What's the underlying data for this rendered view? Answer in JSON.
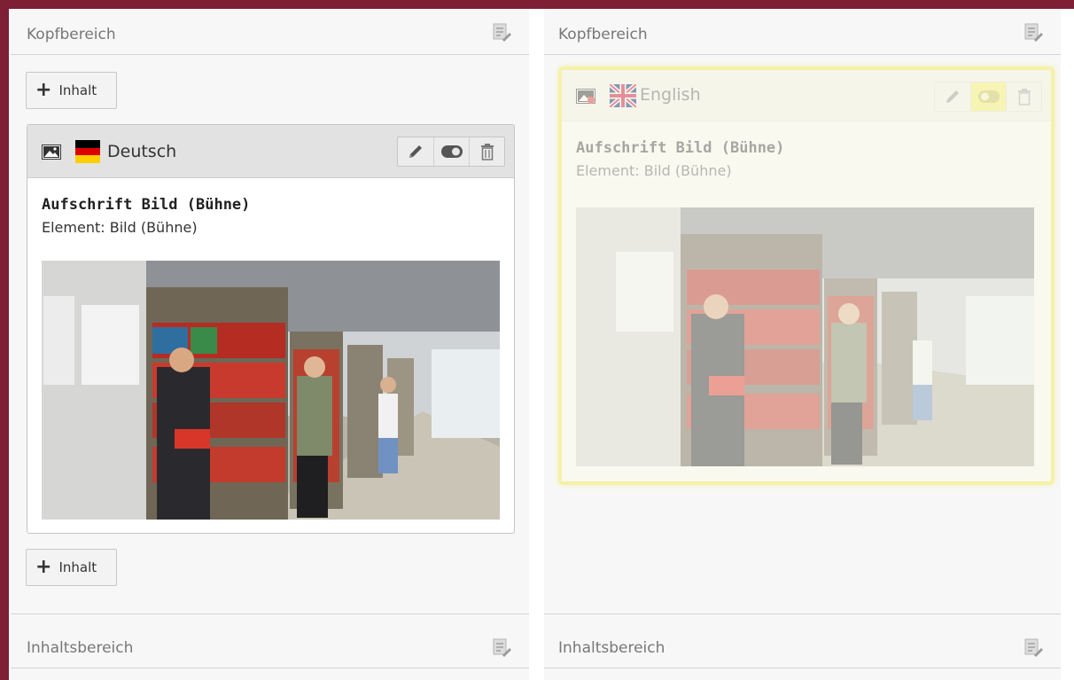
{
  "columns": [
    {
      "header": "Kopfbereich",
      "add_label": "Inhalt",
      "card": {
        "language": "Deutsch",
        "heading": "Aufschrift Bild (Bühne)",
        "element": "Element: Bild (Bühne)"
      },
      "footer_header": "Inhaltsbereich"
    },
    {
      "header": "Kopfbereich",
      "card": {
        "language": "English",
        "heading": "Aufschrift Bild (Bühne)",
        "element": "Element: Bild (Bühne)",
        "status": "hidden"
      },
      "footer_header": "Inhaltsbereich"
    }
  ],
  "colors": {
    "frame": "#7d1f35",
    "hidden_highlight": "#f4ee6d"
  },
  "icons": [
    "page-edit-icon",
    "image-icon",
    "flag-de-icon",
    "flag-uk-icon",
    "pencil-icon",
    "toggle-icon",
    "trash-icon",
    "plus-icon"
  ]
}
